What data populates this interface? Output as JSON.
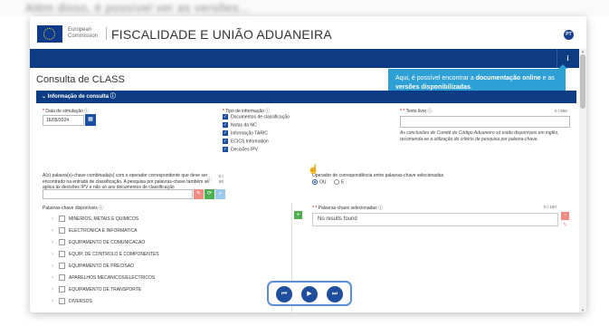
{
  "top_strip": {
    "text": "Além disso, é possível ver as versões..."
  },
  "header": {
    "org_line1": "European",
    "org_line2": "Commission",
    "site_title": "FISCALIDADE E UNIÃO ADUANEIRA",
    "language_badge": "PT"
  },
  "info_button": {
    "label": "i"
  },
  "tooltip": {
    "text_prefix": "Aqui, é possível encontrar a ",
    "bold1": "documentação online",
    "text_mid": " e as ",
    "bold2": "versões disponibilizadas",
    "text_suffix": "."
  },
  "page_title": "Consulta de CLASS",
  "section_header": "Informação de consulta ⓘ",
  "form": {
    "date_label": "Data de simulação ⓘ",
    "date_value": "16/05/2024",
    "type_label": "Tipo de informação ⓘ",
    "type_options": [
      "Documentos de classificação",
      "Notas da NC",
      "Informação TARIC",
      "ECICS Information",
      "Decisões IPV"
    ],
    "free_text_label": "Texto livre ⓘ",
    "free_text_counter": "0 / 900",
    "free_text_note": "As conclusões de Comité do Código Aduaneiro só estão disponíveis em inglês, recomenda-se a utilização do critério de pesquisa por palavra-chave.",
    "keywords_label": "A(s) palavra(s)-chave combinada(s) com o operador correspondente que deve ser encontrado na entrada de classificação. A pesquisa por palavras-chave também se aplica às decisões IPV e não só aos documentos de classificação",
    "keywords_counter_top": "0 /",
    "keywords_counter_bottom": "80",
    "operator_label": "Operador de correspondência entre palavras-chave selecionadas",
    "operator_options": [
      "OU",
      "E"
    ],
    "available_label": "Palavras-chave disponíveis ⓘ",
    "available_items": [
      "MINERIOS, METAIS E QUIMICOS",
      "ELECTRONICA E INFORMATICA",
      "EQUIPAMENTO DE COMUNICACAO",
      "EQUIP. DE CONTROLO E COMPONENTES",
      "EQUIPAMENTO DE PRECISAO",
      "APARELHOS MECANICOS/ELECTRICOS",
      "EQUIPAMENTO DE TRANSPORTE",
      "DIVERSOS"
    ],
    "selected_label": "Palavras-chave selecionadas ⓘ",
    "selected_counter": "0 / 100",
    "selected_empty": "No results found"
  },
  "media_controls": {
    "prev": "⏮",
    "play": "▶",
    "next": "⏭"
  },
  "colors": {
    "primary": "#0d3c84",
    "tooltip": "#2fa0d6",
    "success": "#4caf50",
    "danger_light": "#f28b82"
  }
}
